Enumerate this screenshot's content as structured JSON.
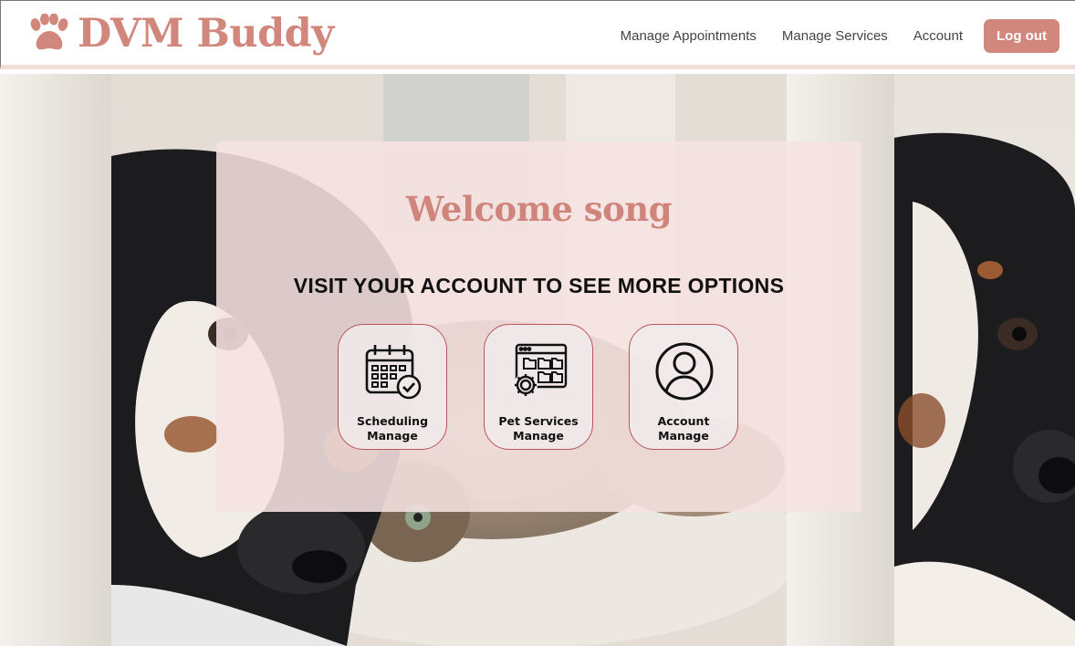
{
  "header": {
    "logo_text": "DVM Buddy",
    "nav": {
      "appointments": "Manage Appointments",
      "services": "Manage Services",
      "account": "Account"
    },
    "logout_label": "Log out"
  },
  "main": {
    "welcome": "Welcome song",
    "subtitle": "VISIT YOUR ACCOUNT TO SEE MORE OPTIONS",
    "tiles": [
      {
        "line1": "Scheduling",
        "line2": "Manage",
        "icon": "calendar-check-icon"
      },
      {
        "line1": "Pet Services",
        "line2": "Manage",
        "icon": "browser-gear-icon"
      },
      {
        "line1": "Account",
        "line2": "Manage",
        "icon": "user-circle-icon"
      }
    ]
  },
  "colors": {
    "brand": "#d2877c",
    "card_bg": "#f6e3e1",
    "tile_border": "#b9565a"
  }
}
